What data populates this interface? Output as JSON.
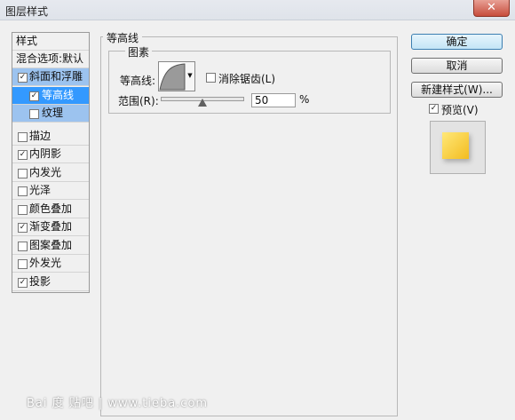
{
  "window": {
    "title": "图层样式",
    "close_glyph": "✕"
  },
  "sidebar": {
    "header": "样式",
    "blend": "混合选项:默认",
    "items": [
      {
        "label": "斜面和浮雕",
        "checked": true
      },
      {
        "label": "等高线",
        "checked": true
      },
      {
        "label": "纹理",
        "checked": false
      },
      {
        "label": "描边",
        "checked": false
      },
      {
        "label": "内阴影",
        "checked": true
      },
      {
        "label": "内发光",
        "checked": false
      },
      {
        "label": "光泽",
        "checked": false
      },
      {
        "label": "颜色叠加",
        "checked": false
      },
      {
        "label": "渐变叠加",
        "checked": true
      },
      {
        "label": "图案叠加",
        "checked": false
      },
      {
        "label": "外发光",
        "checked": false
      },
      {
        "label": "投影",
        "checked": true
      }
    ]
  },
  "panel": {
    "title": "等高线",
    "group_title": "图素",
    "contour_label": "等高线:",
    "antialias_label": "消除锯齿(L)",
    "antialias_checked": false,
    "range_label": "范围(R):",
    "range_value": "50",
    "range_unit": "%"
  },
  "buttons": {
    "ok": "确定",
    "cancel": "取消",
    "new_style": "新建样式(W)..."
  },
  "preview": {
    "label": "预览(V)",
    "checked": true
  },
  "watermark": "Bai 度 贴吧 | www.tieba.com",
  "colors": {
    "selected_bg": "#3399ff",
    "parent_bg": "#9cc3ef",
    "swatch": "#f5c93a"
  }
}
